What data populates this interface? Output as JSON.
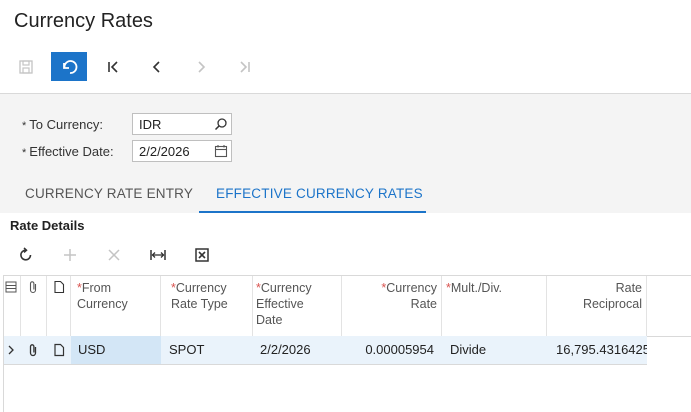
{
  "page": {
    "title": "Currency Rates"
  },
  "form": {
    "to_currency_label": "To Currency:",
    "to_currency_value": "IDR",
    "effective_date_label": "Effective Date:",
    "effective_date_value": "2/2/2026",
    "required_marker": "*"
  },
  "tabs": [
    {
      "label": "CURRENCY RATE ENTRY",
      "active": false
    },
    {
      "label": "EFFECTIVE CURRENCY RATES",
      "active": true
    }
  ],
  "section": {
    "title": "Rate Details"
  },
  "grid": {
    "headers": {
      "from_currency": "From Currency",
      "currency_rate_type": "Currency Rate Type",
      "currency_effective_date": "Currency Effective Date",
      "currency_rate": "Currency Rate",
      "mult_div": "Mult./Div.",
      "rate_reciprocal": "Rate Reciprocal"
    },
    "rows": [
      {
        "from_currency": "USD",
        "currency_rate_type": "SPOT",
        "currency_effective_date": "2/2/2026",
        "currency_rate": "0.00005954",
        "mult_div": "Divide",
        "rate_reciprocal": "16,795.4316425"
      }
    ]
  },
  "colors": {
    "accent": "#1c74c9",
    "form_bg": "#f4f4f4",
    "row_bg": "#eaf3fb"
  }
}
